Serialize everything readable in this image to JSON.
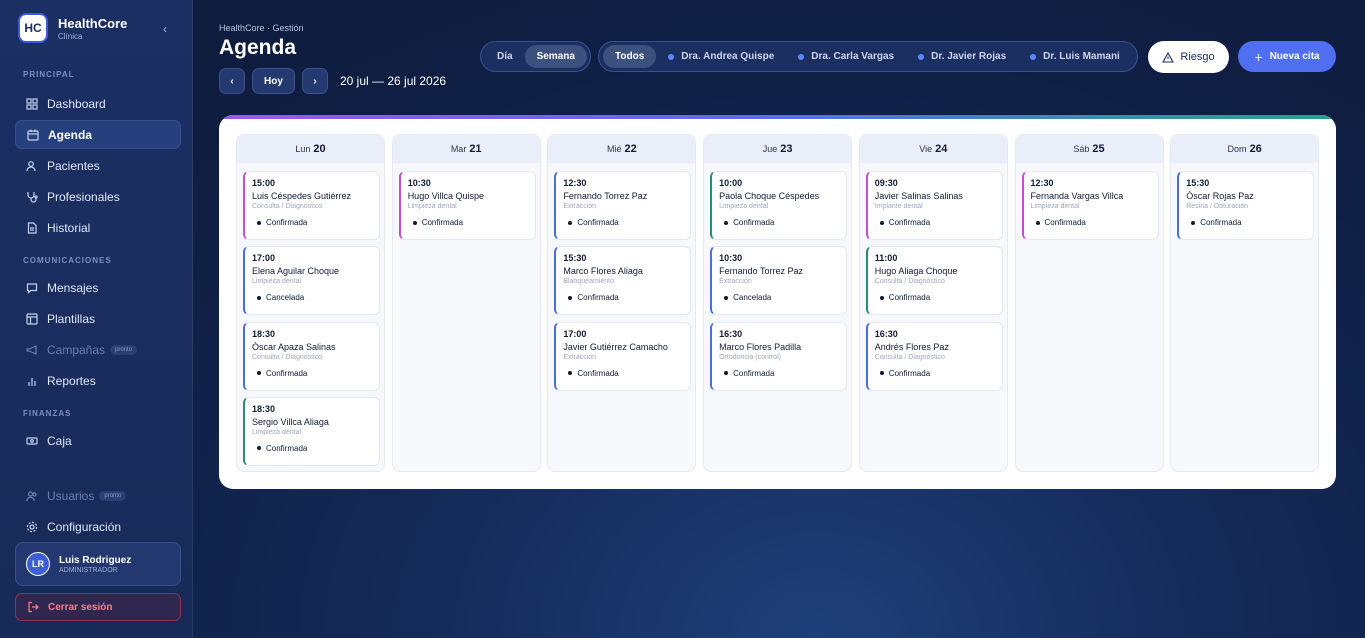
{
  "brand": {
    "logo": "HC",
    "name": "HealthCore",
    "sub": "Clínica",
    "collapse": "‹"
  },
  "sidebar": {
    "sections": {
      "principal": "PRINCIPAL",
      "comunicaciones": "COMUNICACIONES",
      "finanzas": "FINANZAS"
    },
    "items": [
      {
        "label": "Dashboard",
        "icon": "grid-icon"
      },
      {
        "label": "Agenda",
        "icon": "calendar-icon"
      },
      {
        "label": "Pacientes",
        "icon": "users-icon"
      },
      {
        "label": "Profesionales",
        "icon": "stethoscope-icon"
      },
      {
        "label": "Historial",
        "icon": "document-icon"
      },
      {
        "label": "Mensajes",
        "icon": "chat-icon"
      },
      {
        "label": "Plantillas",
        "icon": "template-icon"
      },
      {
        "label": "Campañas",
        "icon": "megaphone-icon",
        "badge": "pronto"
      },
      {
        "label": "Reportes",
        "icon": "bar-chart-icon"
      },
      {
        "label": "Caja",
        "icon": "cash-icon"
      },
      {
        "label": "Usuarios",
        "icon": "users-icon",
        "badge": "pronto"
      },
      {
        "label": "Configuración",
        "icon": "gear-icon"
      }
    ],
    "user": {
      "initials": "LR",
      "name": "Luis Rodriguez",
      "role": "ADMINISTRADOR"
    },
    "logout": "Cerrar sesión"
  },
  "header": {
    "breadcrumb": "HealthCore · Gestión",
    "title": "Agenda",
    "prev": "‹",
    "today": "Hoy",
    "next": "›",
    "range": "20 jul — 26 jul 2026",
    "views": [
      "Día",
      "Semana"
    ],
    "filters": {
      "all": "Todos",
      "doctors": [
        "Dra. Andrea Quispe",
        "Dra. Carla Vargas",
        "Dr. Javier Rojas",
        "Dr. Luis Mamani"
      ]
    },
    "risk": "Riesgo",
    "new": "Nueva cita",
    "colors": {
      "accent": "#4f6ff0",
      "doctor_dot": "#5a86ff"
    }
  },
  "calendar": {
    "days": [
      {
        "dow": "Lun",
        "num": "20",
        "appts": [
          {
            "time": "15:00",
            "name": "Luis Céspedes Gutiérrez",
            "type": "Consulta / Diagnóstico",
            "status": "Confirmada",
            "color": "#c24fcf"
          },
          {
            "time": "17:00",
            "name": "Elena Aguilar Choque",
            "type": "Limpieza dental",
            "status": "Cancelada",
            "color": "#4a6fd8"
          },
          {
            "time": "18:30",
            "name": "Óscar Apaza Salinas",
            "type": "Consulta / Diagnóstico",
            "status": "Confirmada",
            "color": "#4a6fd8"
          },
          {
            "time": "18:30",
            "name": "Sergio Villca Aliaga",
            "type": "Limpieza dental",
            "status": "Confirmada",
            "color": "#2a8a78"
          }
        ]
      },
      {
        "dow": "Mar",
        "num": "21",
        "appts": [
          {
            "time": "10:30",
            "name": "Hugo Villca Quispe",
            "type": "Limpieza dental",
            "status": "Confirmada",
            "color": "#c24fcf"
          }
        ]
      },
      {
        "dow": "Mié",
        "num": "22",
        "appts": [
          {
            "time": "12:30",
            "name": "Fernando Torrez Paz",
            "type": "Extracción",
            "status": "Confirmada",
            "color": "#4a6fd8"
          },
          {
            "time": "15:30",
            "name": "Marco Flores Aliaga",
            "type": "Blanqueamiento",
            "status": "Confirmada",
            "color": "#4a6fd8"
          },
          {
            "time": "17:00",
            "name": "Javier Gutiérrez Camacho",
            "type": "Extracción",
            "status": "Confirmada",
            "color": "#4a6fd8"
          }
        ]
      },
      {
        "dow": "Jue",
        "num": "23",
        "appts": [
          {
            "time": "10:00",
            "name": "Paola Choque Céspedes",
            "type": "Limpieza dental",
            "status": "Confirmada",
            "color": "#2a8a78"
          },
          {
            "time": "10:30",
            "name": "Fernando Torrez Paz",
            "type": "Extracción",
            "status": "Cancelada",
            "color": "#4a6fd8"
          },
          {
            "time": "16:30",
            "name": "Marco Flores Padilla",
            "type": "Ortodoncia (control)",
            "status": "Confirmada",
            "color": "#4a6fd8"
          }
        ]
      },
      {
        "dow": "Vie",
        "num": "24",
        "appts": [
          {
            "time": "09:30",
            "name": "Javier Salinas Salinas",
            "type": "Implante dental",
            "status": "Confirmada",
            "color": "#c24fcf"
          },
          {
            "time": "11:00",
            "name": "Hugo Aliaga Choque",
            "type": "Consulta / Diagnóstico",
            "status": "Confirmada",
            "color": "#2a8a78"
          },
          {
            "time": "16:30",
            "name": "Andrés Flores Paz",
            "type": "Consulta / Diagnóstico",
            "status": "Confirmada",
            "color": "#4a6fd8"
          }
        ]
      },
      {
        "dow": "Sáb",
        "num": "25",
        "appts": [
          {
            "time": "12:30",
            "name": "Fernanda Vargas Villca",
            "type": "Limpieza dental",
            "status": "Confirmada",
            "color": "#c24fcf"
          }
        ]
      },
      {
        "dow": "Dom",
        "num": "26",
        "appts": [
          {
            "time": "15:30",
            "name": "Óscar Rojas Paz",
            "type": "Resina / Obturación",
            "status": "Confirmada",
            "color": "#4a6fd8"
          }
        ]
      }
    ]
  }
}
